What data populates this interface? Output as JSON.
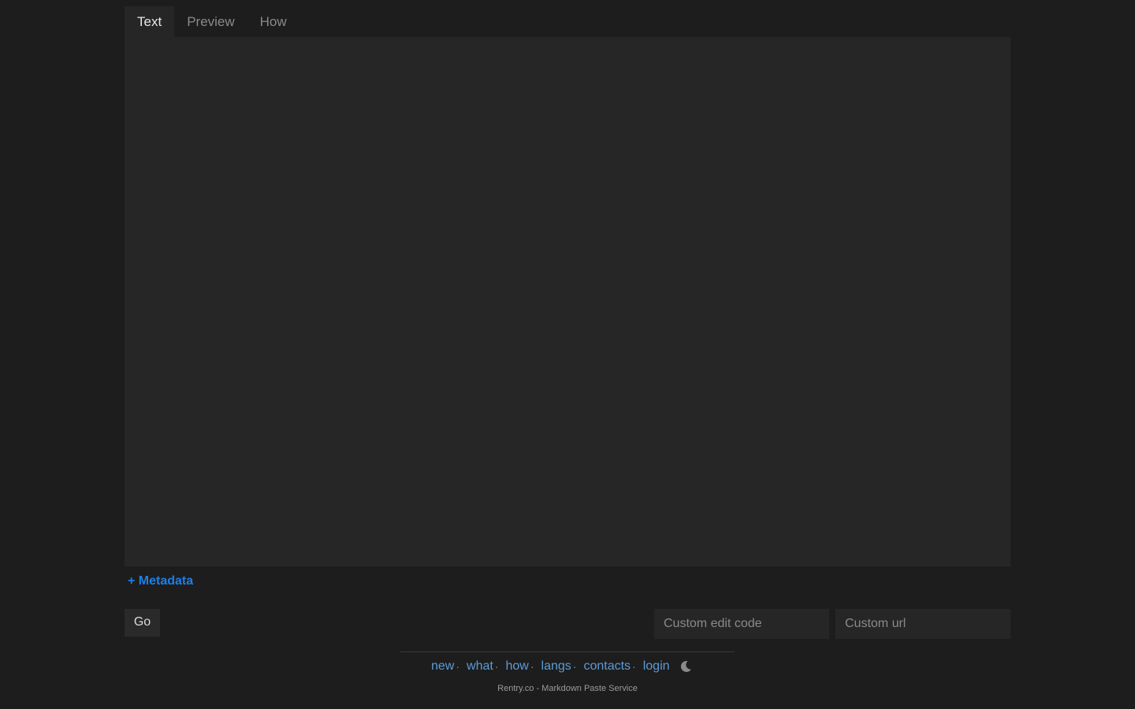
{
  "tabs": [
    {
      "label": "Text",
      "active": true
    },
    {
      "label": "Preview",
      "active": false
    },
    {
      "label": "How",
      "active": false
    }
  ],
  "editor": {
    "value": ""
  },
  "metadata_link": "+ Metadata",
  "go_button": "Go",
  "fields": {
    "edit_code_placeholder": "Custom edit code",
    "custom_url_placeholder": "Custom url"
  },
  "footer": {
    "links": [
      "new",
      "what",
      "how",
      "langs",
      "contacts",
      "login"
    ],
    "separator": "·",
    "theme_icon": "moon-icon",
    "tagline": "Rentry.co - Markdown Paste Service"
  },
  "colors": {
    "background": "#1d1d1d",
    "panel": "#262626",
    "link": "#5c9bd6",
    "accent": "#1e7fe6"
  }
}
